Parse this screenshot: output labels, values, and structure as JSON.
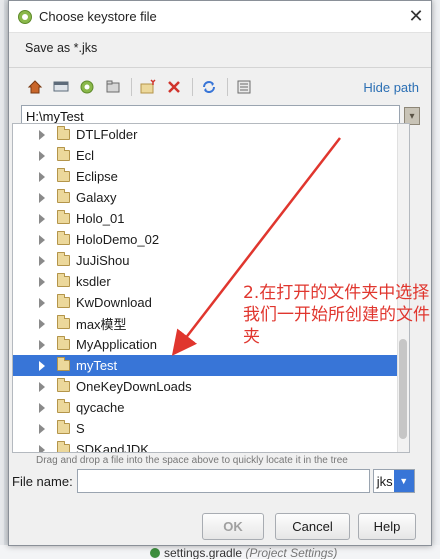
{
  "dialog": {
    "title": "Choose keystore file",
    "description": "Save as *.jks",
    "close_glyph": "✕"
  },
  "toolbar": {
    "icons": [
      "home-icon",
      "desktop-icon",
      "project-icon",
      "module-icon",
      "new-folder-icon",
      "delete-icon",
      "refresh-icon",
      "show-hidden-icon"
    ],
    "hide_path_label": "Hide path"
  },
  "path": {
    "value": "H:\\myTest"
  },
  "tree": {
    "items": [
      {
        "label": "DTLFolder",
        "selected": false
      },
      {
        "label": "Ecl",
        "selected": false
      },
      {
        "label": "Eclipse",
        "selected": false
      },
      {
        "label": "Galaxy",
        "selected": false
      },
      {
        "label": "Holo_01",
        "selected": false
      },
      {
        "label": "HoloDemo_02",
        "selected": false
      },
      {
        "label": "JuJiShou",
        "selected": false
      },
      {
        "label": "ksdler",
        "selected": false
      },
      {
        "label": "KwDownload",
        "selected": false
      },
      {
        "label": "max模型",
        "selected": false
      },
      {
        "label": "MyApplication",
        "selected": false
      },
      {
        "label": "myTest",
        "selected": true
      },
      {
        "label": "OneKeyDownLoads",
        "selected": false
      },
      {
        "label": "qycache",
        "selected": false
      },
      {
        "label": "S",
        "selected": false
      },
      {
        "label": "SDKandJDK",
        "selected": false
      }
    ]
  },
  "hint": "Drag and drop a file into the space above to quickly locate it in the tree",
  "file_name": {
    "label": "File name:",
    "value": "",
    "extension": "jks"
  },
  "buttons": {
    "ok": "OK",
    "cancel": "Cancel",
    "help": "Help"
  },
  "annotation": "2.在打开的文件夹中选择我们一开始所创建的文件夹",
  "background": {
    "bottom_file": "settings.gradle",
    "bottom_sub": "(Project Settings)"
  },
  "colors": {
    "selection": "#3875d7",
    "annotation": "#e0362e",
    "link": "#2b6fb4"
  }
}
